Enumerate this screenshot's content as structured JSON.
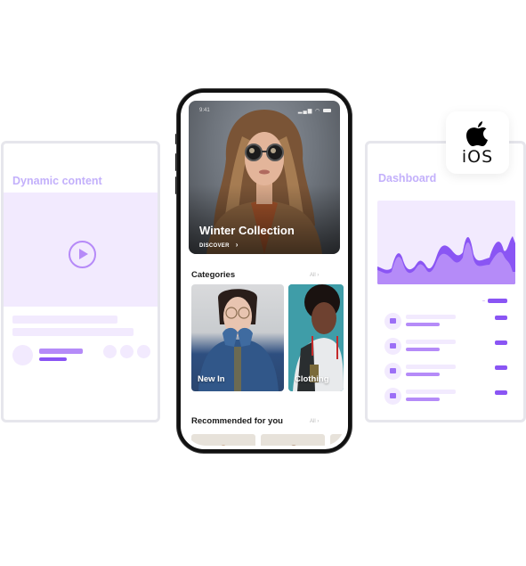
{
  "left_card": {
    "title": "Dynamic content",
    "icon": "play-icon"
  },
  "right_card": {
    "title": "Dashboard",
    "list_rows": 4,
    "row_icon": "image-icon"
  },
  "platform_badge": {
    "icon": "apple-logo-icon",
    "label": "iOS"
  },
  "phone": {
    "status_bar": {
      "time": "9:41",
      "icons": [
        "signal-icon",
        "wifi-icon",
        "battery-icon"
      ]
    },
    "hero": {
      "title": "Winter Collection",
      "cta": "DISCOVER",
      "cta_icon": "chevron-right-icon"
    },
    "categories": {
      "title": "Categories",
      "all_label": "All",
      "items": [
        {
          "label": "New In"
        },
        {
          "label": "Clothing"
        }
      ]
    },
    "recommended": {
      "title": "Recommended for you",
      "all_label": "All"
    }
  },
  "colors": {
    "accent": "#8a55f4",
    "accent_light": "#b58bf8",
    "accent_pale": "#f2eafe",
    "title_lavender": "#c3b0fb",
    "card_border": "#e6e6ec"
  }
}
